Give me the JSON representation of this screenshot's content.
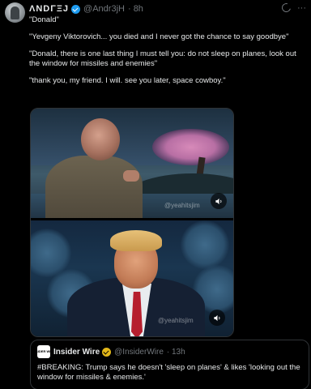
{
  "author": {
    "name": "ΛNDΓΞJ",
    "handle": "@Andr3jH",
    "time": "· 8h"
  },
  "header_actions": {
    "grok_icon": "grok-icon",
    "more_icon": "more-icon",
    "more_label": "···"
  },
  "tweet": {
    "lines": [
      "\"Donald\"",
      "\"Yevgeny Viktorovich... you died and I never got the chance to say goodbye\"",
      "\"Donald, there is one last thing I must tell you: do not sleep on planes, look out the window for missiles and enemies\"",
      "\"thank you, my friend. I will. see you later, space cowboy.\""
    ]
  },
  "media": {
    "videos": [
      {
        "watermark": "@yeahitsjim",
        "audio_icon": "speaker-icon"
      },
      {
        "watermark": "@yeahitsjim",
        "audio_icon": "speaker-icon"
      }
    ]
  },
  "quote": {
    "logo_text": "INSIDER WIRE",
    "name": "Insider Wire",
    "handle": "@InsiderWire",
    "time": "· 13h",
    "text": "#BREAKING: Trump says he doesn't 'sleep on planes' & likes 'looking out the window for missiles & enemies.'"
  },
  "colors": {
    "accent": "#1d9bf0",
    "gold_badge": "#e2b719",
    "tie": "#b61f2e"
  }
}
